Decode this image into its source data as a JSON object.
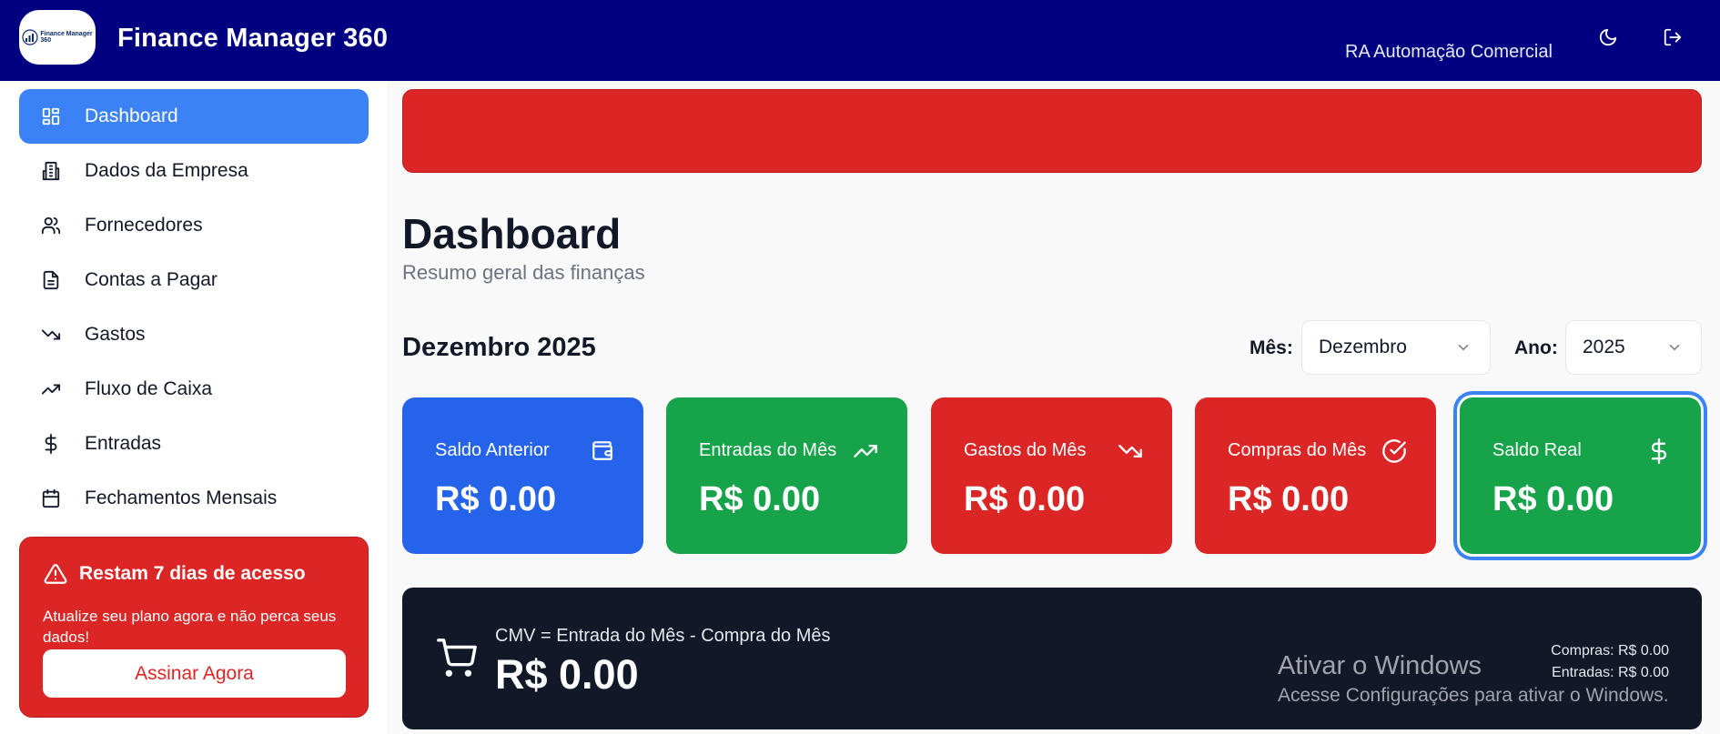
{
  "header": {
    "logo_text": "Finance Manager",
    "logo_sub": "360",
    "app_title": "Finance Manager 360",
    "company": "RA Automação Comercial",
    "theme_icon": "moon-icon",
    "logout_icon": "logout-icon",
    "bg_color": "#000080"
  },
  "sidebar": {
    "items": [
      {
        "label": "Dashboard",
        "icon": "dashboard-grid-icon",
        "active": true
      },
      {
        "label": "Dados da Empresa",
        "icon": "building-icon"
      },
      {
        "label": "Fornecedores",
        "icon": "users-icon"
      },
      {
        "label": "Contas a Pagar",
        "icon": "file-text-icon"
      },
      {
        "label": "Gastos",
        "icon": "trending-down-icon"
      },
      {
        "label": "Fluxo de Caixa",
        "icon": "trending-up-icon"
      },
      {
        "label": "Entradas",
        "icon": "dollar-icon"
      },
      {
        "label": "Fechamentos Mensais",
        "icon": "calendar-icon"
      }
    ],
    "trial": {
      "title": "Restam 7 dias de acesso",
      "message": "Atualize seu plano agora e não perca seus dados!",
      "button": "Assinar Agora",
      "icon": "warning-triangle-icon"
    }
  },
  "main": {
    "title": "Dashboard",
    "subtitle": "Resumo geral das finanças",
    "period": "Dezembro 2025",
    "filters": {
      "month_label": "Mês:",
      "month_value": "Dezembro",
      "year_label": "Ano:",
      "year_value": "2025"
    },
    "cards": [
      {
        "title": "Saldo Anterior",
        "value": "R$ 0.00",
        "icon": "wallet-icon",
        "color": "#2563eb"
      },
      {
        "title": "Entradas do Mês",
        "value": "R$ 0.00",
        "icon": "trending-up-icon",
        "color": "#16a34a"
      },
      {
        "title": "Gastos do Mês",
        "value": "R$ 0.00",
        "icon": "trending-down-icon",
        "color": "#dc2626"
      },
      {
        "title": "Compras do Mês",
        "value": "R$ 0.00",
        "icon": "check-circle-icon",
        "color": "#dc2626"
      },
      {
        "title": "Saldo Real",
        "value": "R$ 0.00",
        "icon": "dollar-icon",
        "color": "#16a34a",
        "selected": true
      }
    ],
    "cmv": {
      "formula": "CMV = Entrada do Mês - Compra do Mês",
      "value": "R$ 0.00",
      "compras": "Compras: R$ 0.00",
      "entradas": "Entradas: R$ 0.00",
      "icon": "shopping-cart-icon"
    }
  },
  "watermark": {
    "line1": "Ativar o Windows",
    "line2": "Acesse Configurações para ativar o Windows."
  }
}
